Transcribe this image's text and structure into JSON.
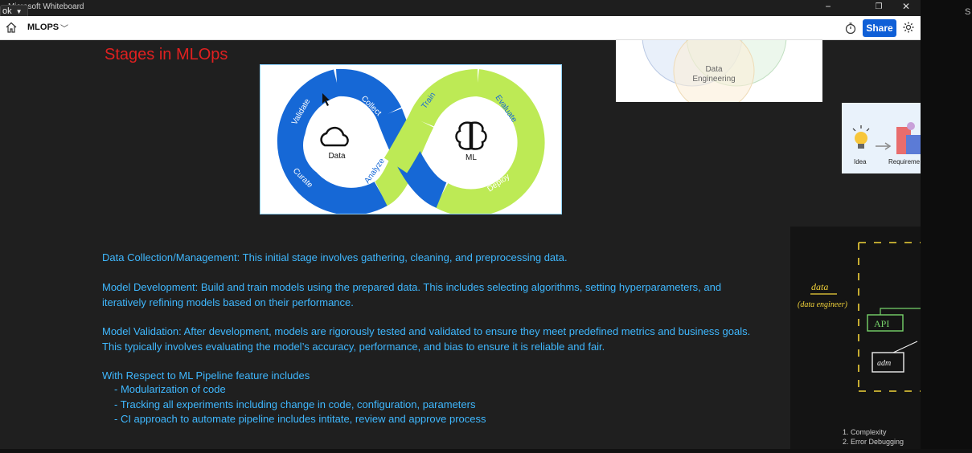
{
  "window": {
    "app_title": "Microsoft Whiteboard",
    "chip_label": "ok",
    "minimize": "−",
    "restore": "❐",
    "close": "✕"
  },
  "toolbar": {
    "board_title": "MLOPS",
    "share_label": "Share"
  },
  "canvas": {
    "heading": "Stages in MLOps",
    "diagram": {
      "left_loop": [
        "Validate",
        "Collect",
        "Curate"
      ],
      "right_loop": [
        "Train",
        "Evaluate",
        "Deploy"
      ],
      "crossing": "Analyze",
      "left_center": "Data",
      "right_center": "ML"
    },
    "venn_card": {
      "label_line1": "Data",
      "label_line2": "Engineering"
    },
    "flow_card": {
      "idea": "Idea",
      "requirements": "Requireme"
    },
    "sketch": {
      "data": "data",
      "data_engineer": "(data engineer)",
      "api": "API",
      "adm": "adm",
      "list": [
        "1.  Complexity",
        "2.  Error Debugging"
      ]
    },
    "paragraphs": [
      "Data Collection/Management: This initial stage involves gathering, cleaning, and preprocessing data.",
      "Model Development: Build and train models using the prepared data. This includes selecting algorithms, setting hyperparameters, and iteratively refining models based on their performance.",
      "Model Validation: After development, models are rigorously tested and validated to ensure they meet predefined metrics and business goals. This typically involves evaluating the model’s accuracy, performance, and bias to ensure it is reliable and fair.",
      "With Respect to ML Pipeline feature includes"
    ],
    "bullets": [
      "- Modularization of code",
      "- Tracking all experiments including change in code, configuration, parameters",
      "- CI approach to automate pipeline includes intitate, review and approve process"
    ]
  },
  "colors": {
    "heading": "#e02020",
    "body_text": "#3fb8ff",
    "share": "#0f5fd7",
    "loop_blue": "#1668d6",
    "loop_green": "#bdea55"
  }
}
